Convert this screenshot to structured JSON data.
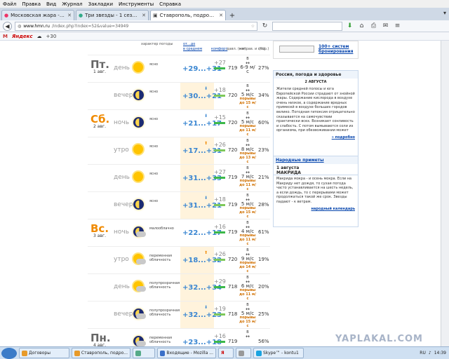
{
  "menu": [
    "Файл",
    "Правка",
    "Вид",
    "Журнал",
    "Закладки",
    "Инструменты",
    "Справка"
  ],
  "tabs": [
    {
      "label": "Московская жара - ЯПлак...",
      "active": false
    },
    {
      "label": "Три звезды - 1 сезон, 5 се...",
      "active": false
    },
    {
      "label": "Ставрополь, подробный ...",
      "active": true
    }
  ],
  "url": {
    "host": "www.hmn.ru",
    "path": "/index.php?index=52&value=34949"
  },
  "bookmarks": {
    "gmail": "M",
    "yandex": "Яндекс",
    "temp": "+30"
  },
  "forecast_header": {
    "c1": "характер погоды",
    "c2a": "от...до",
    "c2b": "в среднем",
    "c3": "комфорт",
    "c4": "давл. (мм)",
    "c5": "направ. и скор.)",
    "c6": "(%)"
  },
  "rows": [
    {
      "dow": "Пт.",
      "date": "1 авг.",
      "part": "день",
      "icon": "sun",
      "cond": "ясно",
      "temp": "+29...+31",
      "arrow": "",
      "feel": "+27",
      "pres": "719",
      "wdir": "В",
      "wspd": "6-9 м/с",
      "gust": "",
      "hum": "27%"
    },
    {
      "dow": "",
      "date": "",
      "part": "вечер",
      "icon": "moon",
      "cond": "ясно",
      "temp": "+30...+21",
      "arrow": "down",
      "feel": "+18",
      "pres": "720",
      "wdir": "В",
      "wspd": "5 м/с",
      "gust": "порывы до 15 м/с",
      "hum": "34%"
    },
    {
      "dow": "Сб.",
      "date": "2 авг.",
      "part": "ночь",
      "icon": "moon",
      "cond": "ясно",
      "temp": "+21...+17",
      "arrow": "down",
      "feel": "+15",
      "pres": "720",
      "wdir": "В",
      "wspd": "5 м/с",
      "gust": "порывы до 11 м/с",
      "hum": "60%"
    },
    {
      "dow": "",
      "date": "",
      "part": "утро",
      "icon": "sun",
      "cond": "ясно",
      "temp": "+17...+31",
      "arrow": "up",
      "feel": "+26",
      "pres": "720",
      "wdir": "В",
      "wspd": "8 м/с",
      "gust": "порывы до 13 м/с",
      "hum": "23%"
    },
    {
      "dow": "",
      "date": "",
      "part": "день",
      "icon": "sun",
      "cond": "ясно",
      "temp": "+31...+33",
      "arrow": "",
      "feel": "+27",
      "pres": "719",
      "wdir": "В",
      "wspd": "7 м/с",
      "gust": "порывы до 11 м/с",
      "hum": "21%"
    },
    {
      "dow": "",
      "date": "",
      "part": "вечер",
      "icon": "moon",
      "cond": "ясно",
      "temp": "+31...+21",
      "arrow": "down",
      "feel": "+18",
      "pres": "719",
      "wdir": "В",
      "wspd": "5 м/с",
      "gust": "порывы до 15 м/с",
      "hum": "28%"
    },
    {
      "dow": "Вс.",
      "date": "3 авг.",
      "part": "ночь",
      "icon": "moon-cloud",
      "cond": "малооблачно",
      "temp": "+22...+17",
      "arrow": "",
      "feel": "+16",
      "pres": "719",
      "wdir": "В",
      "wspd": "4 м/с",
      "gust": "порывы до 11 м/с",
      "hum": "61%"
    },
    {
      "dow": "",
      "date": "",
      "part": "утро",
      "icon": "sun-cloud",
      "cond": "переменная облачность",
      "temp": "+18...+32",
      "arrow": "up",
      "feel": "+26",
      "pres": "720",
      "wdir": "В",
      "wspd": "9 м/с",
      "gust": "порывы до 14 м/с",
      "hum": "19%"
    },
    {
      "dow": "",
      "date": "",
      "part": "день",
      "icon": "sun-cloud",
      "cond": "полупрозрачная облачность",
      "temp": "+32...+34",
      "arrow": "",
      "feel": "+29",
      "pres": "718",
      "wdir": "В",
      "wspd": "6 м/с",
      "gust": "порывы до 11 м/с",
      "hum": "20%"
    },
    {
      "dow": "",
      "date": "",
      "part": "вечер",
      "icon": "moon-cloud",
      "cond": "полупрозрачная облачность",
      "temp": "+32...+23",
      "arrow": "down",
      "feel": "+19",
      "pres": "718",
      "wdir": "В",
      "wspd": "5 м/с",
      "gust": "порывы до 15 м/с",
      "hum": "25%"
    },
    {
      "dow": "Пн.",
      "date": "4 авг.",
      "part": "",
      "icon": "moon-cloud",
      "cond": "переменная облачность",
      "temp": "+23...+18",
      "arrow": "",
      "feel": "+16",
      "pres": "719",
      "wdir": "В",
      "wspd": "",
      "gust": "",
      "hum": "56%"
    }
  ],
  "ad": {
    "label": "100+ систем бронирования"
  },
  "box1": {
    "title": "Россия, погода и здоровье",
    "date": "2 АВГУСТА",
    "text": "Жители средней полосы и юга Европейской России страдают от знойной жары. Содержание кислорода в воздухе очень низкое, а содержание вредных примесей в воздухе больших городов велико. Погодная гипоксия отрицательно сказывается на самочувствии практически всех. Возникает сонливость и слабость. С потом вымываются соли из организма, при обезвоживании может",
    "more": "подробно"
  },
  "box2": {
    "title": "Народные приметы",
    "date": "1 августа",
    "name": "МАКРИДА",
    "text": "Макрида мокра - и осень мокра. Если на Макриду нет дождя, то сухая погода часто устанавливается на шесть недель, а если дождь, то с перерывами может продолжаться такой же срок. Звезды падают - к ветрам.",
    "more": "народный календарь"
  },
  "watermark": "YAPLAKAL.COM",
  "taskbar": {
    "items": [
      "Договоры",
      "Ставрополь, подро...",
      "Входящие - Mozilla ...",
      "Skype™ - kontu1"
    ],
    "lang": "RU",
    "time": "14:39"
  }
}
